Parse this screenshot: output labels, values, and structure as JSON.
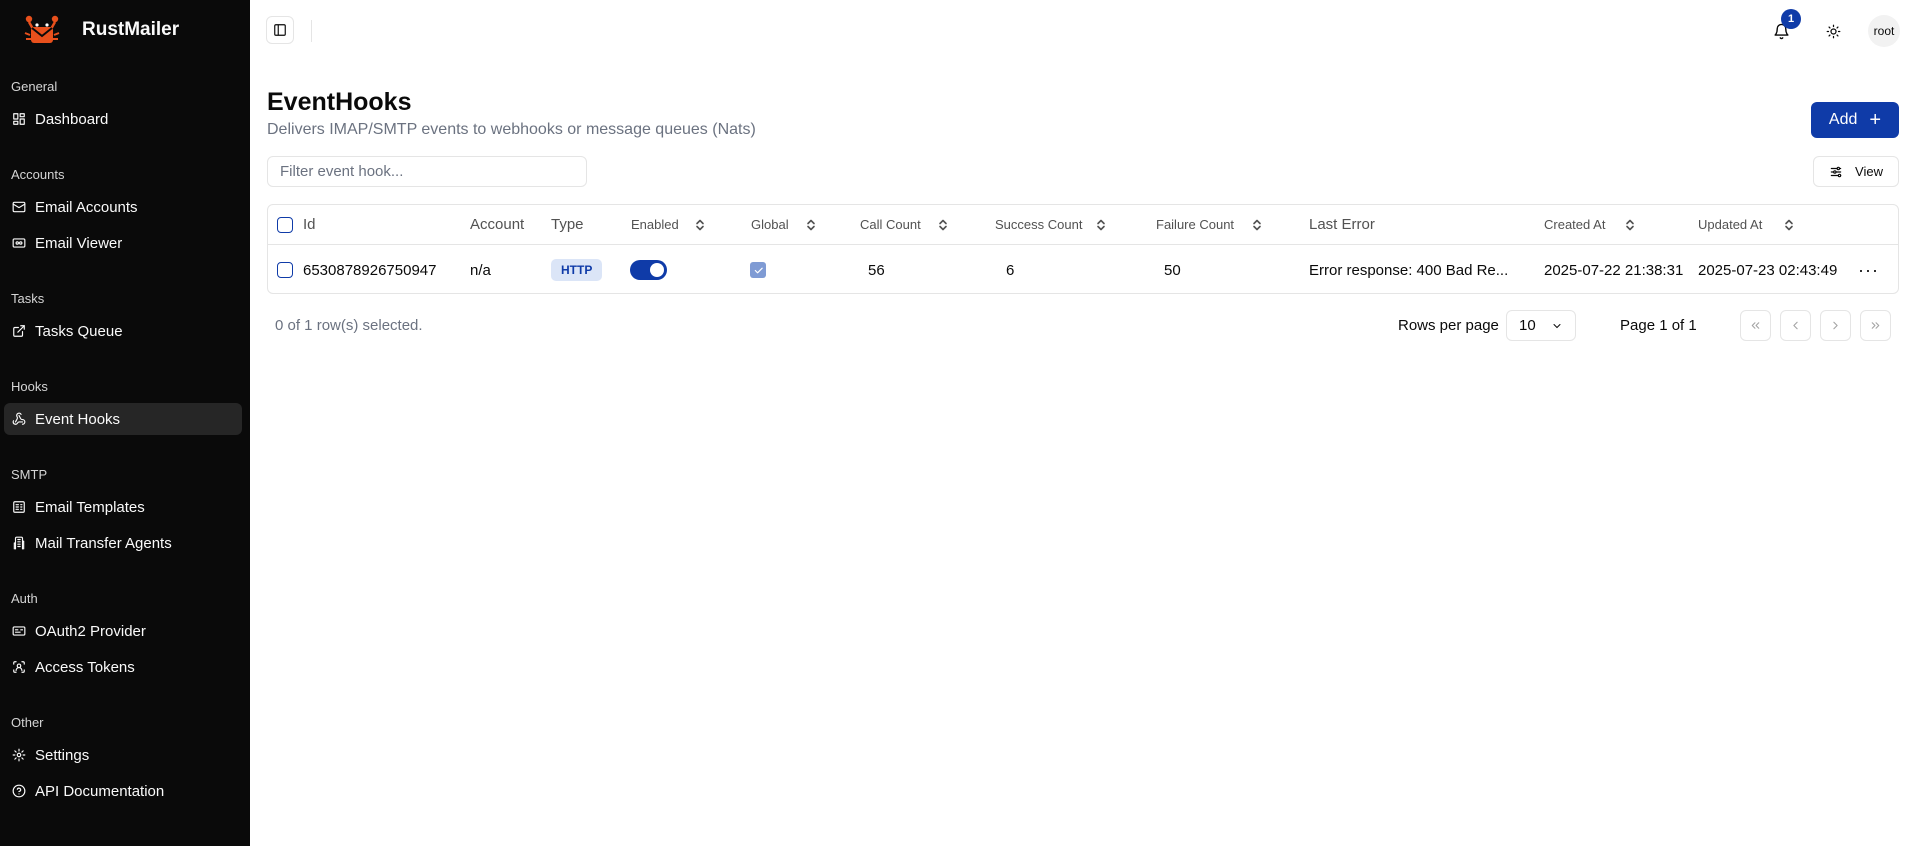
{
  "app": {
    "name": "RustMailer"
  },
  "sidebar": {
    "groups": [
      {
        "label": "General",
        "items": [
          {
            "label": "Dashboard",
            "icon": "dashboard-icon"
          }
        ]
      },
      {
        "label": "Accounts",
        "items": [
          {
            "label": "Email Accounts",
            "icon": "mail-icon"
          },
          {
            "label": "Email Viewer",
            "icon": "viewer-icon"
          }
        ]
      },
      {
        "label": "Tasks",
        "items": [
          {
            "label": "Tasks Queue",
            "icon": "external-link-icon"
          }
        ]
      },
      {
        "label": "Hooks",
        "items": [
          {
            "label": "Event Hooks",
            "icon": "webhook-icon",
            "active": true
          }
        ]
      },
      {
        "label": "SMTP",
        "items": [
          {
            "label": "Email Templates",
            "icon": "template-icon"
          },
          {
            "label": "Mail Transfer Agents",
            "icon": "building-icon"
          }
        ]
      },
      {
        "label": "Auth",
        "items": [
          {
            "label": "OAuth2 Provider",
            "icon": "id-card-icon"
          },
          {
            "label": "Access Tokens",
            "icon": "scan-face-icon"
          }
        ]
      },
      {
        "label": "Other",
        "items": [
          {
            "label": "Settings",
            "icon": "gear-icon"
          },
          {
            "label": "API Documentation",
            "icon": "help-circle-icon"
          }
        ]
      }
    ]
  },
  "header": {
    "notification_count": "1",
    "user": "root"
  },
  "page": {
    "title": "EventHooks",
    "subtitle": "Delivers IMAP/SMTP events to webhooks or message queues (Nats)",
    "add_label": "Add",
    "filter_placeholder": "Filter event hook...",
    "view_label": "View"
  },
  "table": {
    "columns": {
      "id": "Id",
      "account": "Account",
      "type": "Type",
      "enabled": "Enabled",
      "global": "Global",
      "call_count": "Call Count",
      "success_count": "Success Count",
      "failure_count": "Failure Count",
      "last_error": "Last Error",
      "created_at": "Created At",
      "updated_at": "Updated At"
    },
    "rows": [
      {
        "id": "6530878926750947",
        "account": "n/a",
        "type": "HTTP",
        "enabled": true,
        "global": true,
        "call_count": "56",
        "success_count": "6",
        "failure_count": "50",
        "last_error": "Error response: 400 Bad Re...",
        "created_at": "2025-07-22 21:38:31",
        "updated_at": "2025-07-23 02:43:49"
      }
    ]
  },
  "footer": {
    "selected_text": "0 of 1 row(s) selected.",
    "rows_per_page_label": "Rows per page",
    "rows_per_page_value": "10",
    "page_text": "Page 1 of 1"
  },
  "colors": {
    "accent": "#0f3ba8",
    "sidebar_bg": "#0a0a0a",
    "badge_bg": "#dbe5f7"
  }
}
